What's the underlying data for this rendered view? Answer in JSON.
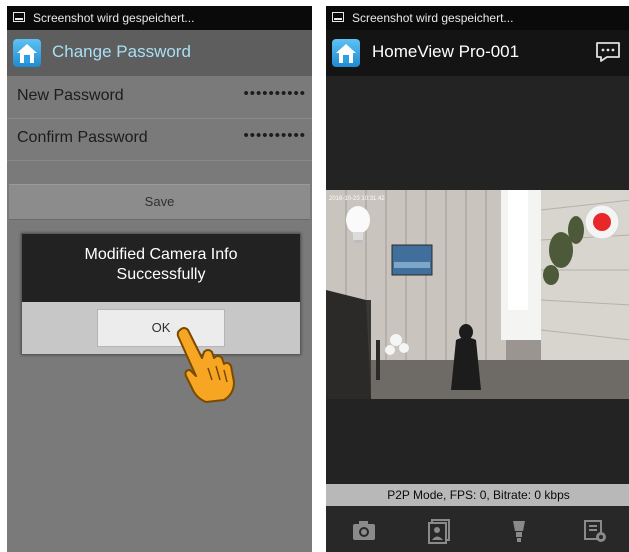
{
  "left_phone": {
    "status_text": "Screenshot wird gespeichert...",
    "app_title": "Change Password",
    "fields": [
      {
        "label": "New Password",
        "value": "••••••••••"
      },
      {
        "label": "Confirm Password",
        "value": "••••••••••"
      }
    ],
    "save_label": "Save",
    "dialog": {
      "message": "Modified Camera Info Successfully",
      "ok_label": "OK"
    }
  },
  "right_phone": {
    "status_text": "Screenshot wird gespeichert...",
    "app_title": "HomeView Pro-001",
    "osd_timestamp": "2016-10-23 10:31:42",
    "info_text": "P2P Mode, FPS: 0, Bitrate: 0 kbps",
    "toolbar_icons": [
      "camera-icon",
      "gallery-icon",
      "light-bulb-icon",
      "settings-list-icon"
    ]
  },
  "colors": {
    "accent_title_left": "#a9dff5",
    "record_red": "#e8272a",
    "logo_blue": "#2a9ee6"
  }
}
